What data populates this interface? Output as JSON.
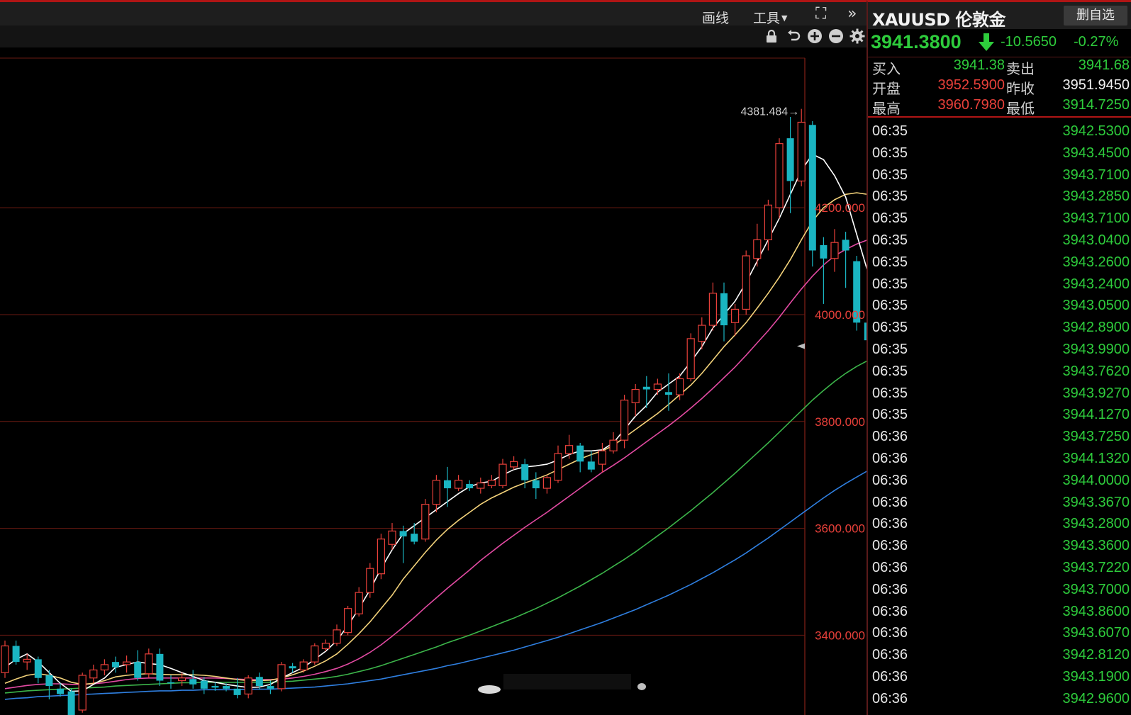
{
  "toolbar": {
    "draw_label": "画线",
    "tools_label": "工具",
    "fullscreen_icon": "fullscreen-icon",
    "more_icon": "double-chevron-right-icon"
  },
  "subtoolbar": {
    "icons": [
      "lock-icon",
      "undo-icon",
      "zoom-in-icon",
      "zoom-out-icon",
      "gear-icon"
    ]
  },
  "colors": {
    "up": "#e8403a",
    "down": "#1ab5c2",
    "price_green": "#2ecc3c",
    "ma5": "#ffffff",
    "ma10": "#f3d27a",
    "ma20": "#e24aa2",
    "ma40": "#3cb54a",
    "ma60": "#2f7fe0",
    "grid": "#6a1a12",
    "axis_label": "#e8403a"
  },
  "chart_data": {
    "type": "candlestick",
    "ylim": [
      3260,
      4480
    ],
    "y_ticks": [
      "4200.000",
      "4000.000",
      "3800.000",
      "3600.000",
      "3400.000"
    ],
    "y_tick_values": [
      4200,
      4000,
      3800,
      3600,
      3400
    ],
    "max_annotation": "4381.484→",
    "max_value": 4381.484,
    "candles": [
      [
        3330,
        3380,
        3320,
        3390
      ],
      [
        3380,
        3350,
        3345,
        3390
      ],
      [
        3350,
        3355,
        3335,
        3365
      ],
      [
        3355,
        3320,
        3310,
        3360
      ],
      [
        3325,
        3305,
        3280,
        3335
      ],
      [
        3300,
        3290,
        3285,
        3310
      ],
      [
        3295,
        3250,
        3245,
        3300
      ],
      [
        3260,
        3325,
        3255,
        3330
      ],
      [
        3320,
        3335,
        3310,
        3345
      ],
      [
        3335,
        3345,
        3325,
        3355
      ],
      [
        3350,
        3340,
        3330,
        3360
      ],
      [
        3345,
        3350,
        3330,
        3362
      ],
      [
        3350,
        3320,
        3315,
        3372
      ],
      [
        3328,
        3365,
        3320,
        3375
      ],
      [
        3365,
        3315,
        3305,
        3375
      ],
      [
        3312,
        3310,
        3300,
        3325
      ],
      [
        3315,
        3320,
        3305,
        3330
      ],
      [
        3318,
        3308,
        3300,
        3335
      ],
      [
        3315,
        3300,
        3290,
        3322
      ],
      [
        3305,
        3302,
        3296,
        3312
      ],
      [
        3305,
        3300,
        3295,
        3310
      ],
      [
        3300,
        3288,
        3282,
        3320
      ],
      [
        3290,
        3320,
        3282,
        3325
      ],
      [
        3322,
        3305,
        3298,
        3330
      ],
      [
        3305,
        3300,
        3290,
        3315
      ],
      [
        3300,
        3345,
        3295,
        3350
      ],
      [
        3342,
        3338,
        3330,
        3348
      ],
      [
        3335,
        3350,
        3330,
        3355
      ],
      [
        3350,
        3380,
        3345,
        3385
      ],
      [
        3375,
        3385,
        3370,
        3392
      ],
      [
        3385,
        3410,
        3380,
        3420
      ],
      [
        3405,
        3450,
        3400,
        3455
      ],
      [
        3440,
        3480,
        3435,
        3490
      ],
      [
        3480,
        3525,
        3470,
        3535
      ],
      [
        3515,
        3580,
        3505,
        3590
      ],
      [
        3570,
        3595,
        3560,
        3610
      ],
      [
        3595,
        3585,
        3535,
        3605
      ],
      [
        3590,
        3575,
        3570,
        3610
      ],
      [
        3580,
        3645,
        3575,
        3655
      ],
      [
        3645,
        3690,
        3630,
        3700
      ],
      [
        3690,
        3675,
        3640,
        3715
      ],
      [
        3675,
        3690,
        3670,
        3700
      ],
      [
        3683,
        3675,
        3670,
        3690
      ],
      [
        3675,
        3685,
        3665,
        3695
      ],
      [
        3680,
        3690,
        3675,
        3700
      ],
      [
        3680,
        3720,
        3675,
        3730
      ],
      [
        3715,
        3725,
        3710,
        3735
      ],
      [
        3720,
        3690,
        3675,
        3730
      ],
      [
        3690,
        3675,
        3655,
        3705
      ],
      [
        3675,
        3695,
        3665,
        3700
      ],
      [
        3690,
        3740,
        3685,
        3755
      ],
      [
        3740,
        3755,
        3730,
        3775
      ],
      [
        3755,
        3725,
        3705,
        3760
      ],
      [
        3725,
        3710,
        3705,
        3745
      ],
      [
        3720,
        3745,
        3705,
        3760
      ],
      [
        3745,
        3765,
        3740,
        3780
      ],
      [
        3765,
        3840,
        3750,
        3850
      ],
      [
        3835,
        3860,
        3810,
        3870
      ],
      [
        3865,
        3860,
        3825,
        3885
      ],
      [
        3860,
        3870,
        3850,
        3880
      ],
      [
        3855,
        3850,
        3820,
        3890
      ],
      [
        3850,
        3880,
        3840,
        3890
      ],
      [
        3880,
        3955,
        3875,
        3965
      ],
      [
        3950,
        3980,
        3935,
        3995
      ],
      [
        3980,
        4040,
        3970,
        4060
      ],
      [
        4040,
        3980,
        3950,
        4060
      ],
      [
        3985,
        4010,
        3960,
        4020
      ],
      [
        4010,
        4110,
        4000,
        4120
      ],
      [
        4105,
        4140,
        4090,
        4170
      ],
      [
        4140,
        4205,
        4120,
        4215
      ],
      [
        4200,
        4320,
        4180,
        4330
      ],
      [
        4330,
        4250,
        4190,
        4370
      ],
      [
        4250,
        4360,
        4240,
        4385
      ],
      [
        4355,
        4120,
        4090,
        4362
      ],
      [
        4130,
        4105,
        4020,
        4145
      ],
      [
        4105,
        4135,
        4080,
        4160
      ],
      [
        4140,
        4120,
        4050,
        4155
      ],
      [
        4100,
        3985,
        3970,
        4110
      ],
      [
        3985,
        3952,
        3895,
        4025
      ],
      [
        3952,
        3941,
        3918,
        3965
      ]
    ],
    "ma5": [
      3340,
      3355,
      3365,
      3350,
      3330,
      3310,
      3295,
      3296,
      3308,
      3320,
      3340,
      3345,
      3350,
      3347,
      3345,
      3338,
      3330,
      3323,
      3315,
      3312,
      3308,
      3305,
      3302,
      3303,
      3308,
      3320,
      3330,
      3340,
      3355,
      3370,
      3390,
      3418,
      3450,
      3485,
      3525,
      3560,
      3590,
      3605,
      3620,
      3635,
      3650,
      3665,
      3678,
      3685,
      3688,
      3700,
      3710,
      3715,
      3717,
      3720,
      3728,
      3738,
      3745,
      3745,
      3747,
      3760,
      3785,
      3810,
      3830,
      3855,
      3870,
      3885,
      3912,
      3940,
      3975,
      4000,
      4025,
      4060,
      4100,
      4140,
      4180,
      4225,
      4270,
      4300,
      4290,
      4260,
      4220,
      4150,
      4080,
      4020
    ],
    "ma10": [
      3310,
      3318,
      3325,
      3328,
      3325,
      3320,
      3312,
      3308,
      3310,
      3315,
      3322,
      3325,
      3327,
      3328,
      3327,
      3326,
      3326,
      3326,
      3325,
      3323,
      3320,
      3317,
      3315,
      3315,
      3316,
      3320,
      3326,
      3333,
      3342,
      3352,
      3365,
      3383,
      3403,
      3425,
      3450,
      3475,
      3505,
      3530,
      3555,
      3578,
      3598,
      3615,
      3630,
      3645,
      3657,
      3667,
      3677,
      3685,
      3692,
      3700,
      3710,
      3720,
      3730,
      3738,
      3745,
      3755,
      3770,
      3785,
      3800,
      3815,
      3832,
      3850,
      3868,
      3890,
      3915,
      3940,
      3962,
      3985,
      4012,
      4040,
      4070,
      4103,
      4140,
      4175,
      4200,
      4215,
      4225,
      4228,
      4225,
      4218
    ],
    "ma20": [
      3300,
      3303,
      3306,
      3308,
      3309,
      3309,
      3308,
      3308,
      3309,
      3311,
      3314,
      3317,
      3319,
      3320,
      3320,
      3320,
      3320,
      3320,
      3320,
      3320,
      3319,
      3318,
      3317,
      3317,
      3317,
      3318,
      3320,
      3323,
      3327,
      3332,
      3338,
      3346,
      3356,
      3368,
      3382,
      3398,
      3415,
      3433,
      3452,
      3470,
      3488,
      3505,
      3522,
      3540,
      3556,
      3572,
      3587,
      3602,
      3616,
      3630,
      3645,
      3660,
      3675,
      3690,
      3705,
      3718,
      3732,
      3747,
      3762,
      3777,
      3792,
      3808,
      3825,
      3843,
      3862,
      3882,
      3902,
      3924,
      3947,
      3970,
      3995,
      4022,
      4048,
      4072,
      4093,
      4110,
      4122,
      4132,
      4140,
      4145
    ],
    "ma40": [
      3292,
      3294,
      3296,
      3297,
      3298,
      3299,
      3300,
      3301,
      3302,
      3303,
      3305,
      3306,
      3307,
      3308,
      3309,
      3310,
      3311,
      3311,
      3312,
      3312,
      3312,
      3312,
      3312,
      3312,
      3312,
      3313,
      3314,
      3316,
      3318,
      3320,
      3323,
      3327,
      3332,
      3337,
      3343,
      3350,
      3357,
      3364,
      3371,
      3378,
      3386,
      3393,
      3400,
      3408,
      3416,
      3424,
      3432,
      3441,
      3450,
      3460,
      3470,
      3481,
      3492,
      3504,
      3516,
      3529,
      3542,
      3556,
      3571,
      3586,
      3601,
      3617,
      3633,
      3650,
      3667,
      3685,
      3703,
      3722,
      3741,
      3760,
      3780,
      3800,
      3820,
      3840,
      3858,
      3875,
      3890,
      3903,
      3914,
      3922
    ],
    "ma60": [
      3280,
      3282,
      3283,
      3285,
      3286,
      3287,
      3288,
      3289,
      3290,
      3291,
      3292,
      3293,
      3294,
      3295,
      3296,
      3296,
      3297,
      3297,
      3298,
      3298,
      3298,
      3298,
      3299,
      3299,
      3299,
      3300,
      3301,
      3302,
      3303,
      3305,
      3307,
      3309,
      3312,
      3315,
      3318,
      3322,
      3326,
      3330,
      3334,
      3338,
      3343,
      3347,
      3352,
      3357,
      3362,
      3367,
      3372,
      3378,
      3384,
      3390,
      3396,
      3403,
      3410,
      3417,
      3424,
      3432,
      3440,
      3448,
      3457,
      3466,
      3475,
      3485,
      3495,
      3506,
      3517,
      3529,
      3541,
      3554,
      3568,
      3582,
      3597,
      3612,
      3627,
      3642,
      3657,
      3671,
      3684,
      3696,
      3708,
      3718
    ]
  },
  "panel": {
    "symbol": "XAUUSD 伦敦金",
    "remove_watch_label": "删自选",
    "last_price": "3941.3800",
    "change": "-10.5650",
    "change_pct": "-0.27%",
    "arrow_icon": "down-arrow-icon",
    "quote": {
      "buy_label": "买入",
      "buy": "3941.38",
      "sell_label": "卖出",
      "sell": "3941.68",
      "open_label": "开盘",
      "open": "3952.5900",
      "prev_close_label": "昨收",
      "prev_close": "3951.9450",
      "high_label": "最高",
      "high": "3960.7980",
      "low_label": "最低",
      "low": "3914.7250"
    },
    "ticks": [
      {
        "time": "06:35",
        "price": "3942.5300"
      },
      {
        "time": "06:35",
        "price": "3943.4500"
      },
      {
        "time": "06:35",
        "price": "3943.7100"
      },
      {
        "time": "06:35",
        "price": "3943.2850"
      },
      {
        "time": "06:35",
        "price": "3943.7100"
      },
      {
        "time": "06:35",
        "price": "3943.0400"
      },
      {
        "time": "06:35",
        "price": "3943.2600"
      },
      {
        "time": "06:35",
        "price": "3943.2400"
      },
      {
        "time": "06:35",
        "price": "3943.0500"
      },
      {
        "time": "06:35",
        "price": "3942.8900"
      },
      {
        "time": "06:35",
        "price": "3943.9900"
      },
      {
        "time": "06:35",
        "price": "3943.7620"
      },
      {
        "time": "06:35",
        "price": "3943.9270"
      },
      {
        "time": "06:35",
        "price": "3944.1270"
      },
      {
        "time": "06:36",
        "price": "3943.7250"
      },
      {
        "time": "06:36",
        "price": "3944.1320"
      },
      {
        "time": "06:36",
        "price": "3944.0000"
      },
      {
        "time": "06:36",
        "price": "3943.3670"
      },
      {
        "time": "06:36",
        "price": "3943.2800"
      },
      {
        "time": "06:36",
        "price": "3943.3600"
      },
      {
        "time": "06:36",
        "price": "3943.7220"
      },
      {
        "time": "06:36",
        "price": "3943.7000"
      },
      {
        "time": "06:36",
        "price": "3943.8600"
      },
      {
        "time": "06:36",
        "price": "3943.6070"
      },
      {
        "time": "06:36",
        "price": "3942.8120"
      },
      {
        "time": "06:36",
        "price": "3943.1900"
      },
      {
        "time": "06:36",
        "price": "3942.9600"
      }
    ]
  }
}
